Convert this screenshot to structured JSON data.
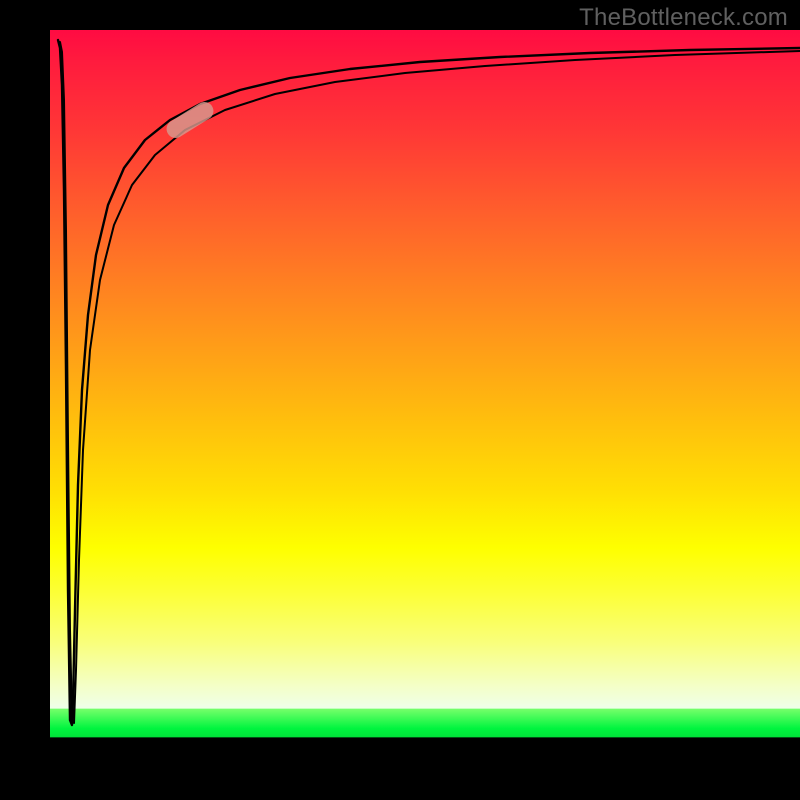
{
  "watermark": "TheBottleneck.com",
  "chart_data": {
    "type": "line",
    "title": "",
    "xlabel": "",
    "ylabel": "",
    "xlim": [
      0,
      100
    ],
    "ylim": [
      0,
      100
    ],
    "grid": false,
    "legend": false,
    "series": [
      {
        "name": "bottleneck-curve",
        "x": [
          0.5,
          1.0,
          1.5,
          2.0,
          2.5,
          3.0,
          4.0,
          5.0,
          6.5,
          8.0,
          10.0,
          12.5,
          15.0,
          18.0,
          22.0,
          28.0,
          35.0,
          45.0,
          58.0,
          72.0,
          86.0,
          100.0
        ],
        "y": [
          98.0,
          95.0,
          60.0,
          3.0,
          40.0,
          58.0,
          68.0,
          74.0,
          79.0,
          82.5,
          85.5,
          88.0,
          89.8,
          91.3,
          92.6,
          93.8,
          94.8,
          95.6,
          96.3,
          96.8,
          97.1,
          97.4
        ]
      }
    ],
    "marker": {
      "label": "operating-point",
      "x": 18.5,
      "y": 87.5,
      "angle_deg": -30
    },
    "background_gradient_stops": [
      {
        "pct": 0,
        "color": "#ff0b42"
      },
      {
        "pct": 34,
        "color": "#ff7c23"
      },
      {
        "pct": 64,
        "color": "#ffdf04"
      },
      {
        "pct": 85,
        "color": "#f9ff7a"
      },
      {
        "pct": 94.2,
        "color": "#efffe9"
      },
      {
        "pct": 97,
        "color": "#00f53f"
      }
    ]
  }
}
